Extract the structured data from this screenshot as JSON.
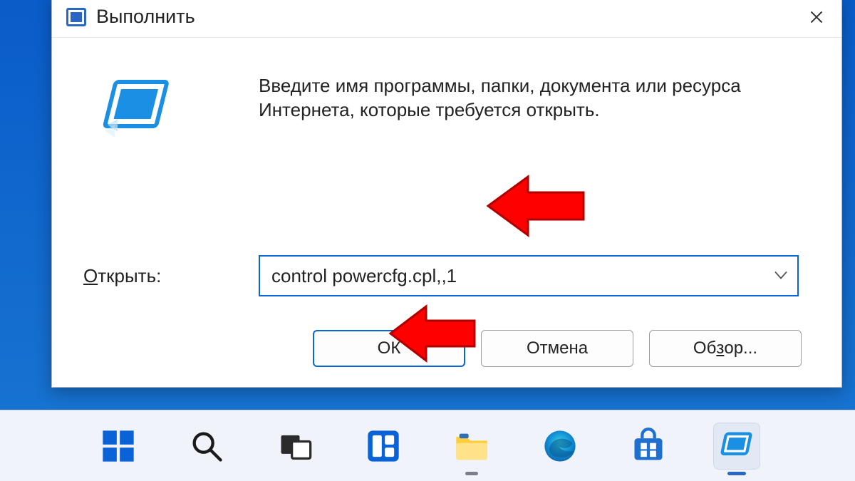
{
  "dialog": {
    "title": "Выполнить",
    "description": "Введите имя программы, папки, документа или ресурса Интернета, которые требуется открыть.",
    "open_label_prefix_underlined": "О",
    "open_label_rest": "ткрыть:",
    "input_value": "control powercfg.cpl,,1",
    "buttons": {
      "ok": "ОК",
      "cancel": "Отмена",
      "browse_prefix": "Об",
      "browse_underlined": "з",
      "browse_rest": "ор..."
    }
  }
}
